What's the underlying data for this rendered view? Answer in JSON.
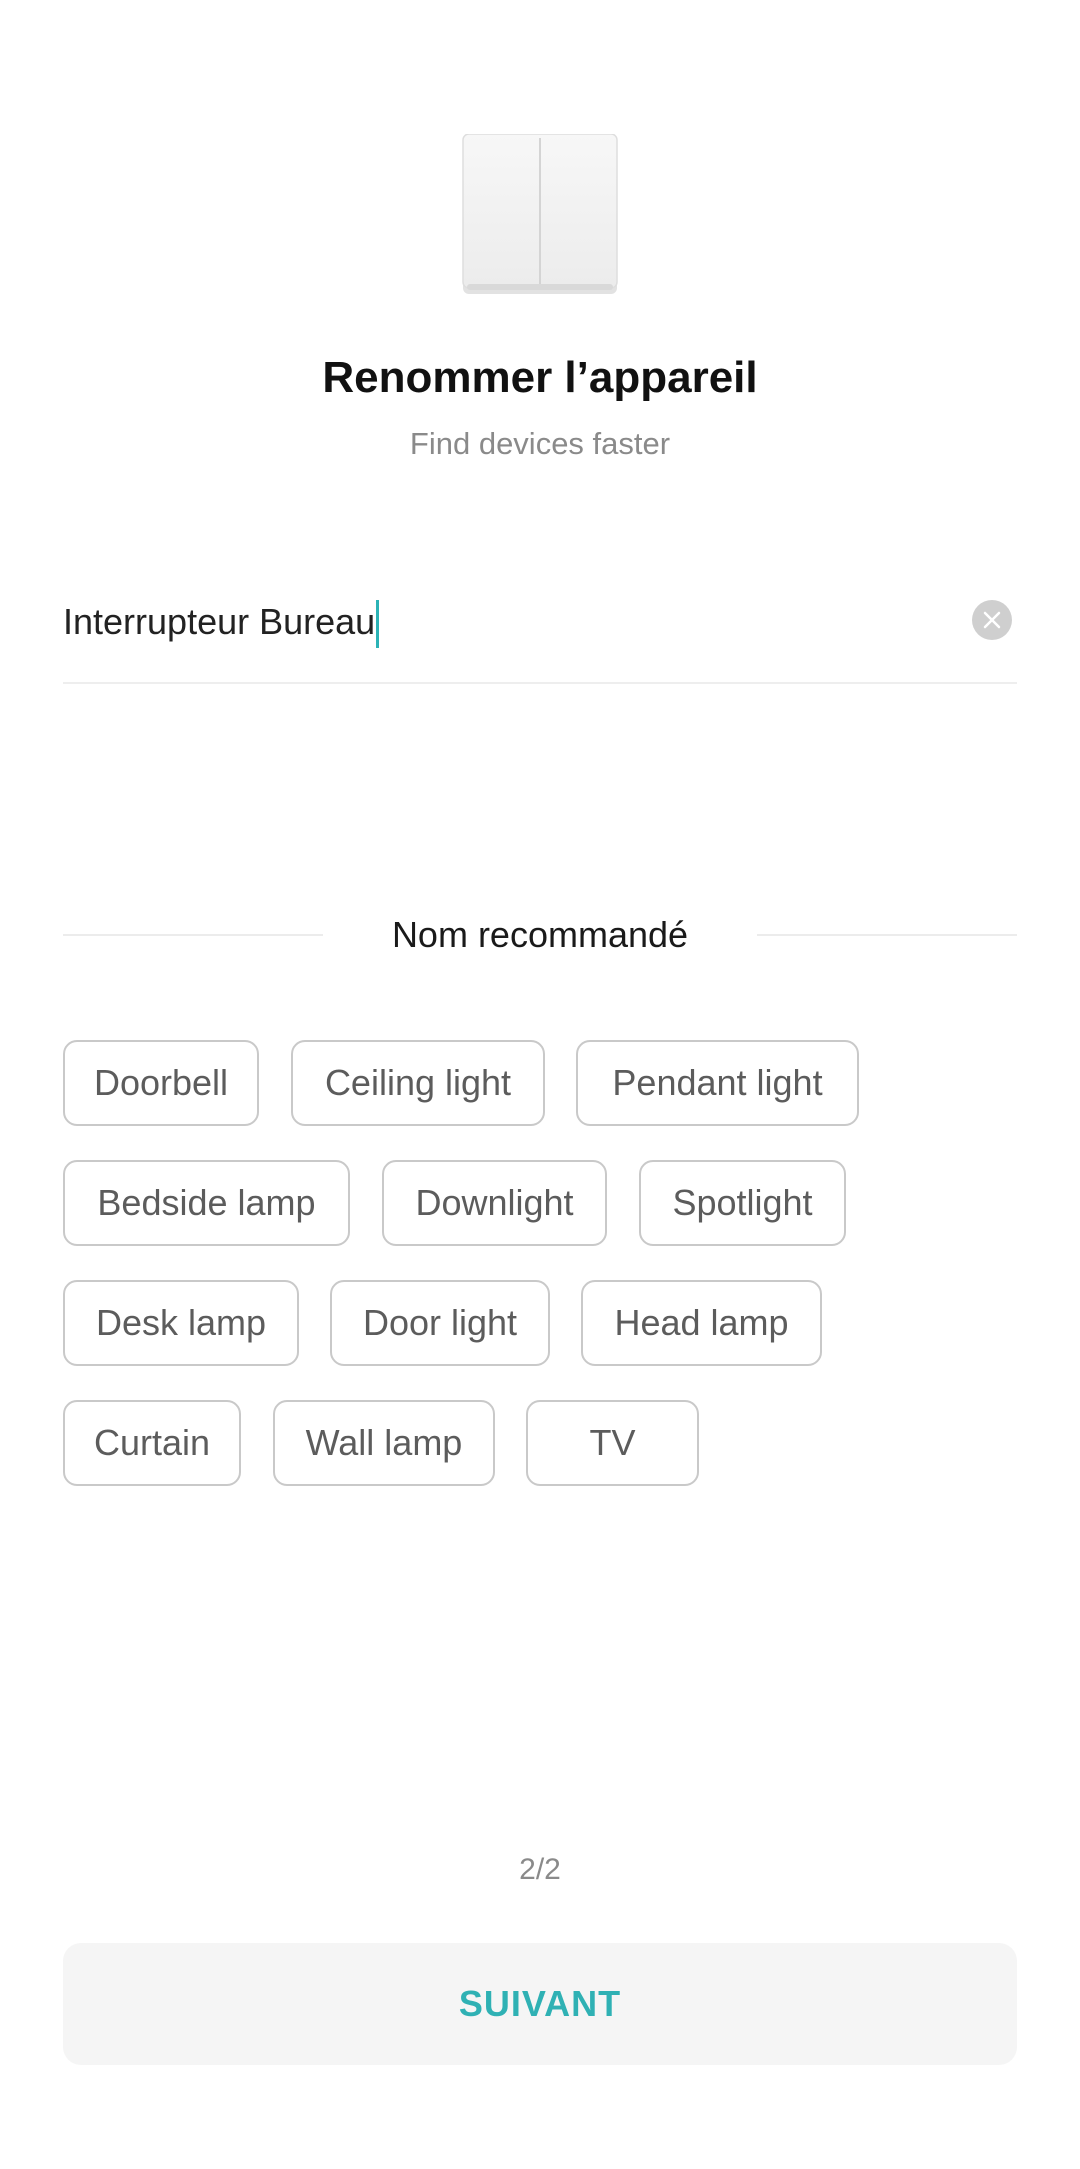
{
  "header": {
    "device_icon": "two-gang-wall-switch-icon",
    "title": "Renommer l’appareil",
    "subtitle": "Find devices faster"
  },
  "name_field": {
    "value": "Interrupteur Bureau",
    "clear_icon": "clear-circle-icon"
  },
  "recommended": {
    "title": "Nom recommandé",
    "chips": [
      "Doorbell",
      "Ceiling light",
      "Pendant light",
      "Bedside lamp",
      "Downlight",
      "Spotlight",
      "Desk lamp",
      "Door light",
      "Head lamp",
      "Curtain",
      "Wall lamp",
      "TV"
    ]
  },
  "footer": {
    "page_indicator": "2/2",
    "next_label": "SUIVANT"
  },
  "colors": {
    "accent": "#2fb1b4",
    "chip_border": "#c9c9c9",
    "button_bg": "#f5f5f5"
  }
}
